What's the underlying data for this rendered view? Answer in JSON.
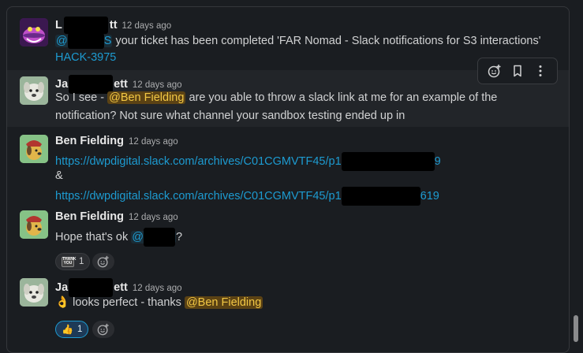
{
  "messages": [
    {
      "sender_prefix": "L",
      "sender_suffix": "tt",
      "time": "12 days ago",
      "line1_mention_suffix": "S",
      "line1_text": "your ticket has been completed 'FAR Nomad - Slack notifications for S3 interactions'",
      "line2_link": "HACK-3975"
    },
    {
      "sender_prefix": "Ja",
      "sender_suffix": "ett",
      "time": "12 days ago",
      "line1_pre": "So I see - ",
      "line1_mention": "@Ben Fielding",
      "line1_post": " are you able to throw a slack link at me for an example of the",
      "line2_text": "notification? Not sure what channel your sandbox testing ended up in"
    },
    {
      "sender": "Ben Fielding",
      "time": "12 days ago",
      "link1_start": "https://dwpdigital.slack.com/archives/C01CGMVTF45/p1",
      "link1_end": "9",
      "ampersand": "&",
      "link2_start": "https://dwpdigital.slack.com/archives/C01CGMVTF45/p1",
      "link2_end": "619"
    },
    {
      "sender": "Ben Fielding",
      "time": "12 days ago",
      "text_pre": "Hope that's ok ",
      "mention_prefix": "@",
      "text_post": "?",
      "reaction_count": "1"
    },
    {
      "sender_prefix": "Ja",
      "sender_suffix": "ett",
      "time": "12 days ago",
      "emoji": "👌",
      "text_pre": " looks perfect - thanks ",
      "mention": "@Ben Fielding",
      "reaction_count": "1"
    }
  ],
  "colors": {
    "background": "#1a1d21",
    "link": "#1d9bd1",
    "self_mention_text": "#f2c744",
    "self_mention_bg": "#5b4214"
  },
  "toolbar": {
    "icons": [
      "add-reaction-icon",
      "bookmark-icon",
      "more-actions-icon"
    ]
  }
}
